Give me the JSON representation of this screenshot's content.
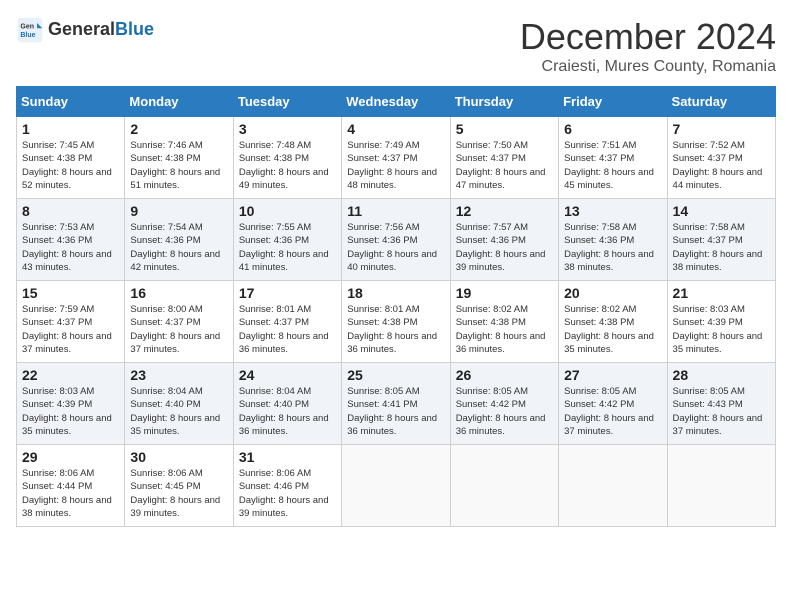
{
  "header": {
    "logo_general": "General",
    "logo_blue": "Blue",
    "month_title": "December 2024",
    "location": "Craiesti, Mures County, Romania"
  },
  "days_of_week": [
    "Sunday",
    "Monday",
    "Tuesday",
    "Wednesday",
    "Thursday",
    "Friday",
    "Saturday"
  ],
  "weeks": [
    [
      {
        "day": "1",
        "sunrise": "7:45 AM",
        "sunset": "4:38 PM",
        "daylight": "8 hours and 52 minutes."
      },
      {
        "day": "2",
        "sunrise": "7:46 AM",
        "sunset": "4:38 PM",
        "daylight": "8 hours and 51 minutes."
      },
      {
        "day": "3",
        "sunrise": "7:48 AM",
        "sunset": "4:38 PM",
        "daylight": "8 hours and 49 minutes."
      },
      {
        "day": "4",
        "sunrise": "7:49 AM",
        "sunset": "4:37 PM",
        "daylight": "8 hours and 48 minutes."
      },
      {
        "day": "5",
        "sunrise": "7:50 AM",
        "sunset": "4:37 PM",
        "daylight": "8 hours and 47 minutes."
      },
      {
        "day": "6",
        "sunrise": "7:51 AM",
        "sunset": "4:37 PM",
        "daylight": "8 hours and 45 minutes."
      },
      {
        "day": "7",
        "sunrise": "7:52 AM",
        "sunset": "4:37 PM",
        "daylight": "8 hours and 44 minutes."
      }
    ],
    [
      {
        "day": "8",
        "sunrise": "7:53 AM",
        "sunset": "4:36 PM",
        "daylight": "8 hours and 43 minutes."
      },
      {
        "day": "9",
        "sunrise": "7:54 AM",
        "sunset": "4:36 PM",
        "daylight": "8 hours and 42 minutes."
      },
      {
        "day": "10",
        "sunrise": "7:55 AM",
        "sunset": "4:36 PM",
        "daylight": "8 hours and 41 minutes."
      },
      {
        "day": "11",
        "sunrise": "7:56 AM",
        "sunset": "4:36 PM",
        "daylight": "8 hours and 40 minutes."
      },
      {
        "day": "12",
        "sunrise": "7:57 AM",
        "sunset": "4:36 PM",
        "daylight": "8 hours and 39 minutes."
      },
      {
        "day": "13",
        "sunrise": "7:58 AM",
        "sunset": "4:36 PM",
        "daylight": "8 hours and 38 minutes."
      },
      {
        "day": "14",
        "sunrise": "7:58 AM",
        "sunset": "4:37 PM",
        "daylight": "8 hours and 38 minutes."
      }
    ],
    [
      {
        "day": "15",
        "sunrise": "7:59 AM",
        "sunset": "4:37 PM",
        "daylight": "8 hours and 37 minutes."
      },
      {
        "day": "16",
        "sunrise": "8:00 AM",
        "sunset": "4:37 PM",
        "daylight": "8 hours and 37 minutes."
      },
      {
        "day": "17",
        "sunrise": "8:01 AM",
        "sunset": "4:37 PM",
        "daylight": "8 hours and 36 minutes."
      },
      {
        "day": "18",
        "sunrise": "8:01 AM",
        "sunset": "4:38 PM",
        "daylight": "8 hours and 36 minutes."
      },
      {
        "day": "19",
        "sunrise": "8:02 AM",
        "sunset": "4:38 PM",
        "daylight": "8 hours and 36 minutes."
      },
      {
        "day": "20",
        "sunrise": "8:02 AM",
        "sunset": "4:38 PM",
        "daylight": "8 hours and 35 minutes."
      },
      {
        "day": "21",
        "sunrise": "8:03 AM",
        "sunset": "4:39 PM",
        "daylight": "8 hours and 35 minutes."
      }
    ],
    [
      {
        "day": "22",
        "sunrise": "8:03 AM",
        "sunset": "4:39 PM",
        "daylight": "8 hours and 35 minutes."
      },
      {
        "day": "23",
        "sunrise": "8:04 AM",
        "sunset": "4:40 PM",
        "daylight": "8 hours and 35 minutes."
      },
      {
        "day": "24",
        "sunrise": "8:04 AM",
        "sunset": "4:40 PM",
        "daylight": "8 hours and 36 minutes."
      },
      {
        "day": "25",
        "sunrise": "8:05 AM",
        "sunset": "4:41 PM",
        "daylight": "8 hours and 36 minutes."
      },
      {
        "day": "26",
        "sunrise": "8:05 AM",
        "sunset": "4:42 PM",
        "daylight": "8 hours and 36 minutes."
      },
      {
        "day": "27",
        "sunrise": "8:05 AM",
        "sunset": "4:42 PM",
        "daylight": "8 hours and 37 minutes."
      },
      {
        "day": "28",
        "sunrise": "8:05 AM",
        "sunset": "4:43 PM",
        "daylight": "8 hours and 37 minutes."
      }
    ],
    [
      {
        "day": "29",
        "sunrise": "8:06 AM",
        "sunset": "4:44 PM",
        "daylight": "8 hours and 38 minutes."
      },
      {
        "day": "30",
        "sunrise": "8:06 AM",
        "sunset": "4:45 PM",
        "daylight": "8 hours and 39 minutes."
      },
      {
        "day": "31",
        "sunrise": "8:06 AM",
        "sunset": "4:46 PM",
        "daylight": "8 hours and 39 minutes."
      },
      null,
      null,
      null,
      null
    ]
  ],
  "labels": {
    "sunrise": "Sunrise:",
    "sunset": "Sunset:",
    "daylight": "Daylight:"
  }
}
